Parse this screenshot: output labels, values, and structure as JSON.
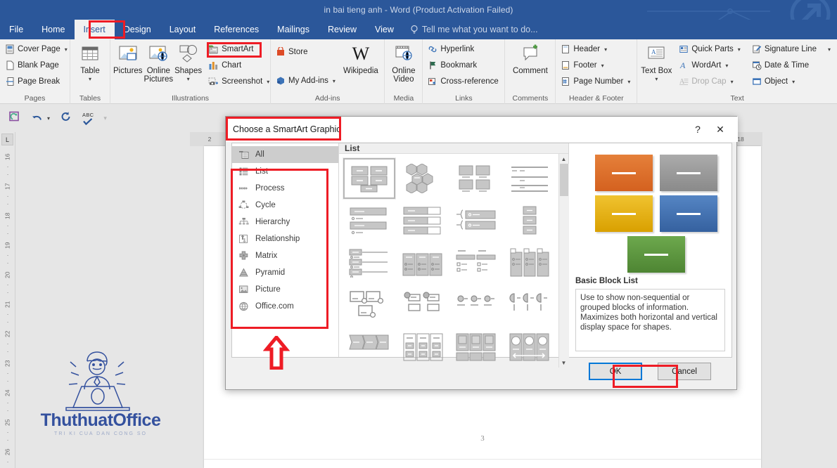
{
  "window": {
    "title": "in bai tieng anh - Word (Product Activation Failed)"
  },
  "tabs": [
    {
      "label": "File"
    },
    {
      "label": "Home"
    },
    {
      "label": "Insert"
    },
    {
      "label": "Design"
    },
    {
      "label": "Layout"
    },
    {
      "label": "References"
    },
    {
      "label": "Mailings"
    },
    {
      "label": "Review"
    },
    {
      "label": "View"
    }
  ],
  "tellme": {
    "label": "Tell me what you want to do..."
  },
  "ribbon": {
    "groups": [
      {
        "name": "Pages",
        "label": "Pages",
        "items": [
          {
            "label": "Cover Page",
            "caret": true
          },
          {
            "label": "Blank Page",
            "caret": false
          },
          {
            "label": "Page Break",
            "caret": false
          }
        ]
      },
      {
        "name": "Tables",
        "label": "Tables",
        "items": [
          {
            "label": "Table",
            "caret": true
          }
        ]
      },
      {
        "name": "Illustrations",
        "label": "Illustrations",
        "items": [
          {
            "label": "Pictures"
          },
          {
            "label": "Online Pictures"
          },
          {
            "label": "Shapes",
            "caret": true
          },
          {
            "label": "SmartArt"
          },
          {
            "label": "Chart"
          },
          {
            "label": "Screenshot",
            "caret": true
          }
        ]
      },
      {
        "name": "Add-ins",
        "label": "Add-ins",
        "items": [
          {
            "label": "Store"
          },
          {
            "label": "My Add-ins",
            "caret": true
          },
          {
            "label": "Wikipedia"
          }
        ]
      },
      {
        "name": "Media",
        "label": "Media",
        "items": [
          {
            "label": "Online Video"
          }
        ]
      },
      {
        "name": "Links",
        "label": "Links",
        "items": [
          {
            "label": "Hyperlink"
          },
          {
            "label": "Bookmark"
          },
          {
            "label": "Cross-reference"
          }
        ]
      },
      {
        "name": "Comments",
        "label": "Comments",
        "items": [
          {
            "label": "Comment"
          }
        ]
      },
      {
        "name": "Header & Footer",
        "label": "Header & Footer",
        "items": [
          {
            "label": "Header",
            "caret": true
          },
          {
            "label": "Footer",
            "caret": true
          },
          {
            "label": "Page Number",
            "caret": true
          }
        ]
      },
      {
        "name": "Text",
        "label": "Text",
        "items": [
          {
            "label": "Text Box",
            "caret": true
          },
          {
            "label": "Quick Parts",
            "caret": true
          },
          {
            "label": "WordArt",
            "caret": true
          },
          {
            "label": "Drop Cap",
            "caret": true,
            "disabled": true
          },
          {
            "label": "Signature Line",
            "caret": true
          },
          {
            "label": "Date & Time"
          },
          {
            "label": "Object",
            "caret": true
          }
        ]
      }
    ]
  },
  "quick_access": {
    "items": [
      {
        "name": "save-icon",
        "label": "Save"
      },
      {
        "name": "undo-icon",
        "label": "Undo"
      },
      {
        "name": "redo-icon",
        "label": "Redo"
      },
      {
        "name": "spelling-icon",
        "label": "Spelling & Grammar"
      },
      {
        "name": "customize-qat-icon",
        "label": "Customize Quick Access Toolbar"
      }
    ]
  },
  "rulers": {
    "corner_label": "L",
    "vertical_ticks": [
      "16",
      "17",
      "18",
      "19",
      "20",
      "21",
      "22",
      "23",
      "24",
      "25",
      "26"
    ],
    "horizontal_ticks": [
      "2",
      "18"
    ]
  },
  "document": {
    "page_number": "3"
  },
  "watermark": {
    "brand": "ThuthuatOffice",
    "tagline": "TRI KI CUA DAN CONG SO"
  },
  "dialog": {
    "title": "Choose a SmartArt Graphic",
    "help_icon": "?",
    "close_icon": "✕",
    "gallery_header": "List",
    "categories": [
      {
        "label": "All",
        "icon": "all-icon",
        "selected": true
      },
      {
        "label": "List",
        "icon": "list-icon",
        "selected": false
      },
      {
        "label": "Process",
        "icon": "process-icon",
        "selected": false
      },
      {
        "label": "Cycle",
        "icon": "cycle-icon",
        "selected": false
      },
      {
        "label": "Hierarchy",
        "icon": "hierarchy-icon",
        "selected": false
      },
      {
        "label": "Relationship",
        "icon": "relationship-icon",
        "selected": false
      },
      {
        "label": "Matrix",
        "icon": "matrix-icon",
        "selected": false
      },
      {
        "label": "Pyramid",
        "icon": "pyramid-icon",
        "selected": false
      },
      {
        "label": "Picture",
        "icon": "picture-icon",
        "selected": false
      },
      {
        "label": "Office.com",
        "icon": "office-com-icon",
        "selected": false
      }
    ],
    "preview": {
      "name": "Basic Block List",
      "description": "Use to show non-sequential or grouped blocks of information. Maximizes both horizontal and vertical display space for shapes.",
      "block_colors": [
        "#E06A26",
        "#9A9A9A",
        "#E8B419",
        "#4373B8",
        "#5E9A3E"
      ]
    },
    "buttons": {
      "ok": "OK",
      "cancel": "Cancel"
    }
  },
  "annotations": {
    "highlight_color": "#ee1c25",
    "boxes": [
      "insert-tab",
      "smartart-button",
      "dialog-title",
      "category-list",
      "ok-button"
    ],
    "arrow": "up-arrow pointing at category list"
  }
}
